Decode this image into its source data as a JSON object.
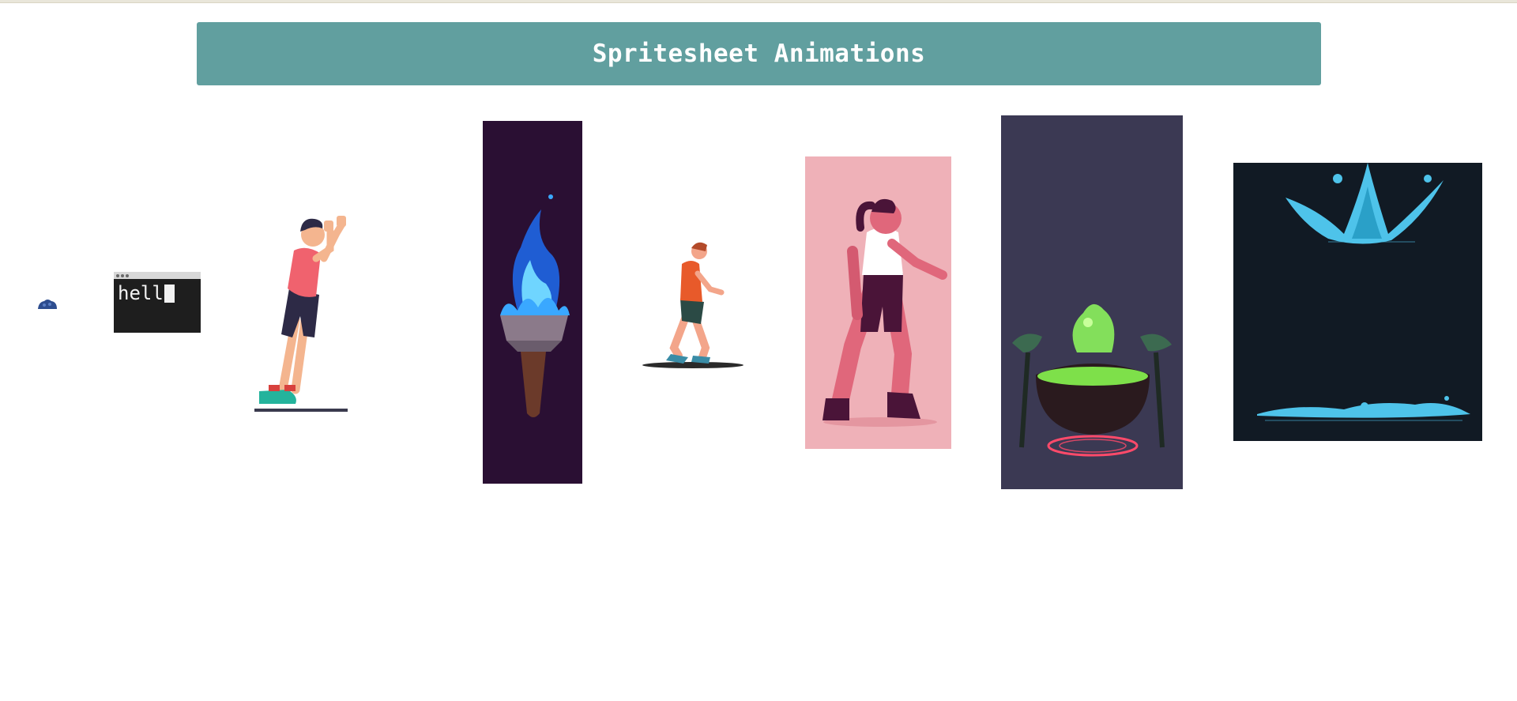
{
  "page": {
    "title": "Spritesheet Animations"
  },
  "terminal": {
    "typed_text": "hell"
  },
  "sprites": [
    {
      "name": "blob",
      "background": "transparent",
      "accent": "#2d4d8f"
    },
    {
      "name": "typing-terminal",
      "background": "#1e1e1e"
    },
    {
      "name": "pushing-man",
      "background": "#ffffff",
      "accent": "#f06070"
    },
    {
      "name": "blue-flame-torch",
      "background": "#2a0f33",
      "accent": "#3aa8ff"
    },
    {
      "name": "running-man",
      "background": "#ffffff",
      "accent": "#e85a2a"
    },
    {
      "name": "walking-woman",
      "background": "#efb1b8",
      "accent": "#5a1a40"
    },
    {
      "name": "witch-cauldron",
      "background": "#3b3953",
      "accent": "#8cf25c"
    },
    {
      "name": "water-splash",
      "background": "#111a24",
      "accent": "#4ec3ea"
    }
  ]
}
